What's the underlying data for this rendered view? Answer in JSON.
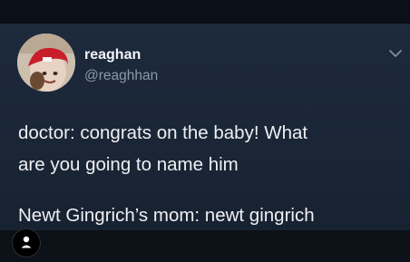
{
  "tweet": {
    "display_name": "reaghan",
    "handle": "@reaghhan",
    "text_lines": [
      "doctor: congrats on the baby! What",
      "are you going to name him",
      "Newt Gingrich’s mom: newt gingrich"
    ]
  },
  "icons": {
    "menu": "chevron-down-icon",
    "profile": "person-icon"
  },
  "colors": {
    "card_background": "#1d2a3c",
    "frame_background": "#0b0f17",
    "handle_text": "#8a98a8",
    "primary_text": "#eef0f3"
  }
}
